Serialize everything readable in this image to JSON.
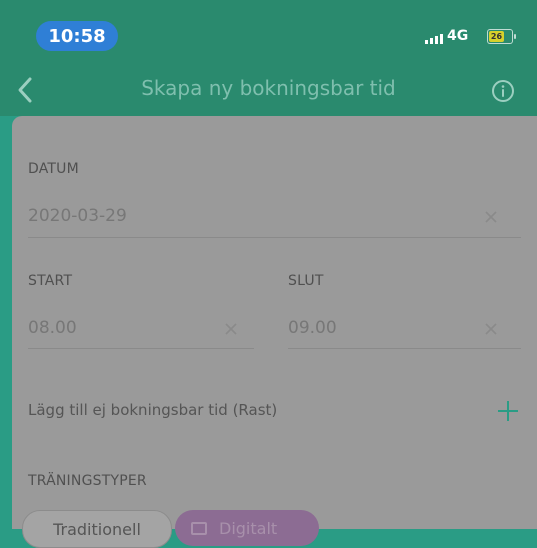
{
  "status_bar": {
    "time": "10:58",
    "network": "4G",
    "battery": "26"
  },
  "nav": {
    "title": "Skapa ny bokningsbar tid"
  },
  "form": {
    "date": {
      "label": "DATUM",
      "value": "2020-03-29"
    },
    "start": {
      "label": "START",
      "value": "08.00"
    },
    "end": {
      "label": "SLUT",
      "value": "09.00"
    },
    "rast_label": "Lägg till ej bokningsbar tid (Rast)",
    "training_types": {
      "label": "TRÄNINGSTYPER",
      "options": [
        {
          "label": "Traditionell",
          "selected": false
        },
        {
          "label": "Digitalt",
          "selected": true
        }
      ]
    }
  },
  "colors": {
    "header": "#2a8a6e",
    "time_pill": "#2f7fd6",
    "accent_green": "#2a9c85",
    "selected_chip": "#8c6c93"
  }
}
